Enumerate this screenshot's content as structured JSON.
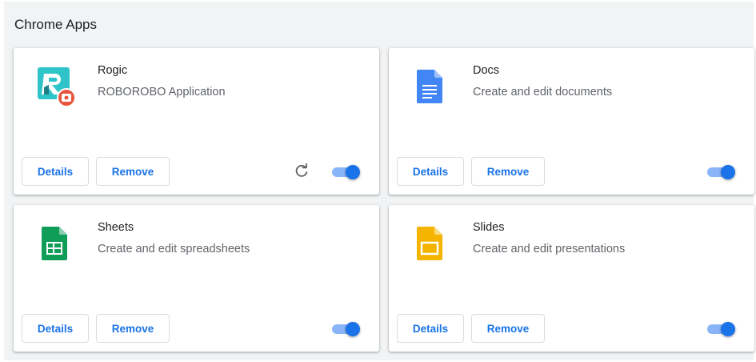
{
  "section": {
    "title": "Chrome Apps"
  },
  "apps": [
    {
      "name": "Rogic",
      "description": "ROBOROBO Application",
      "icon": "rogic-app-icon",
      "details_label": "Details",
      "remove_label": "Remove",
      "has_reload": true,
      "reload_icon": "reload-icon",
      "enabled": true
    },
    {
      "name": "Docs",
      "description": "Create and edit documents",
      "icon": "docs-app-icon",
      "details_label": "Details",
      "remove_label": "Remove",
      "has_reload": false,
      "enabled": true
    },
    {
      "name": "Sheets",
      "description": "Create and edit spreadsheets",
      "icon": "sheets-app-icon",
      "details_label": "Details",
      "remove_label": "Remove",
      "has_reload": false,
      "enabled": true
    },
    {
      "name": "Slides",
      "description": "Create and edit presentations",
      "icon": "slides-app-icon",
      "details_label": "Details",
      "remove_label": "Remove",
      "has_reload": false,
      "enabled": true
    }
  ],
  "colors": {
    "accent": "#1a73e8",
    "toggle_track": "#8ab4f8",
    "docs": "#4285f4",
    "sheets": "#0f9d58",
    "slides": "#f4b400",
    "rogic_teal": "#2ec4c9",
    "rogic_badge": "#e8553e"
  }
}
